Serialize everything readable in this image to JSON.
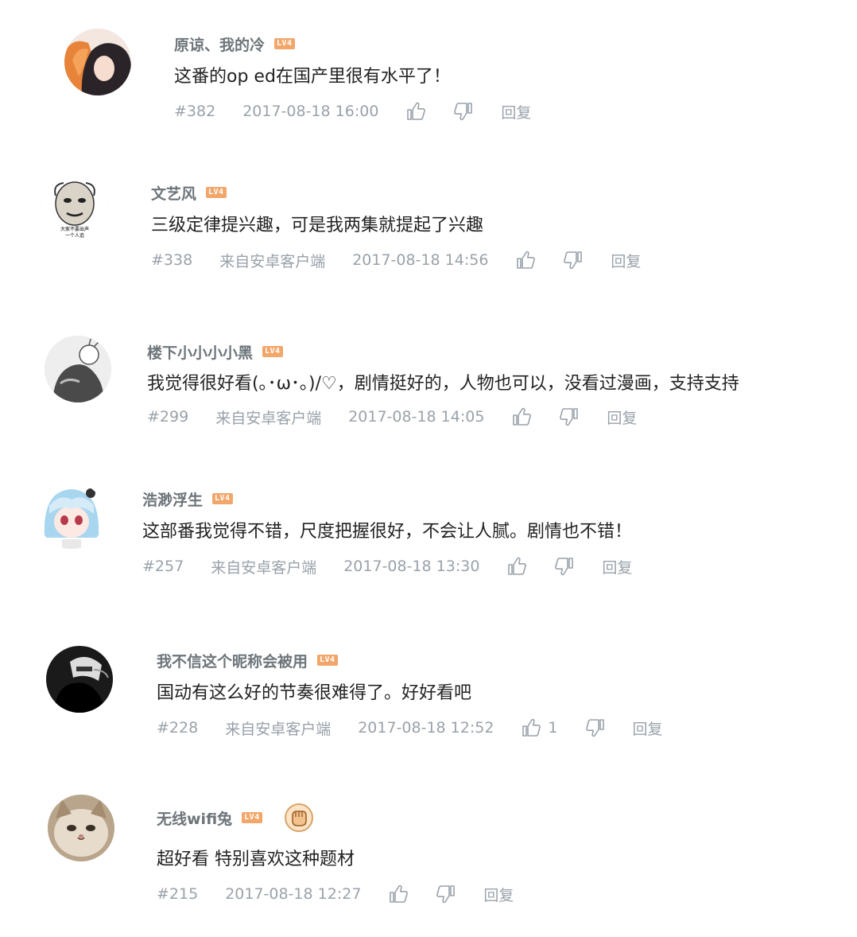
{
  "level_badge": "LV4",
  "reply_label": "回复",
  "comments": [
    {
      "username": "原谅、我的冷",
      "text": "这番的op ed在国产里很有水平了！",
      "floor": "#382",
      "source": "",
      "time": "2017-08-18 16:00",
      "likes": ""
    },
    {
      "username": "文艺风",
      "text": "三级定律提兴趣，可是我两集就提起了兴趣",
      "floor": "#338",
      "source": "来自安卓客户端",
      "time": "2017-08-18 14:56",
      "likes": "",
      "avatar_caption": [
        "大家不要出声",
        "一个人追"
      ]
    },
    {
      "username": "楼下小小小小黑",
      "text": "我觉得很好看(｡･ω･｡)/♡，剧情挺好的，人物也可以，没看过漫画，支持支持",
      "floor": "#299",
      "source": "来自安卓客户端",
      "time": "2017-08-18 14:05",
      "likes": ""
    },
    {
      "username": "浩渺浮生",
      "text": "这部番我觉得不错，尺度把握很好，不会让人腻。剧情也不错！",
      "floor": "#257",
      "source": "来自安卓客户端",
      "time": "2017-08-18 13:30",
      "likes": ""
    },
    {
      "username": "我不信这个昵称会被用",
      "text": "国动有这么好的节奏很难得了。好好看吧",
      "floor": "#228",
      "source": "来自安卓客户端",
      "time": "2017-08-18 12:52",
      "likes": "1"
    },
    {
      "username": "无线wifi兔",
      "text": "超好看 特别喜欢这种题材",
      "floor": "#215",
      "source": "",
      "time": "2017-08-18 12:27",
      "likes": ""
    }
  ],
  "icons": {
    "like": "thumb-up-icon",
    "dislike": "thumb-down-icon",
    "medal": "fist-medal-icon"
  },
  "colors": {
    "username": "#6d757a",
    "meta": "#99a2aa",
    "level_badge": "#f3a66a",
    "text": "#222222"
  }
}
